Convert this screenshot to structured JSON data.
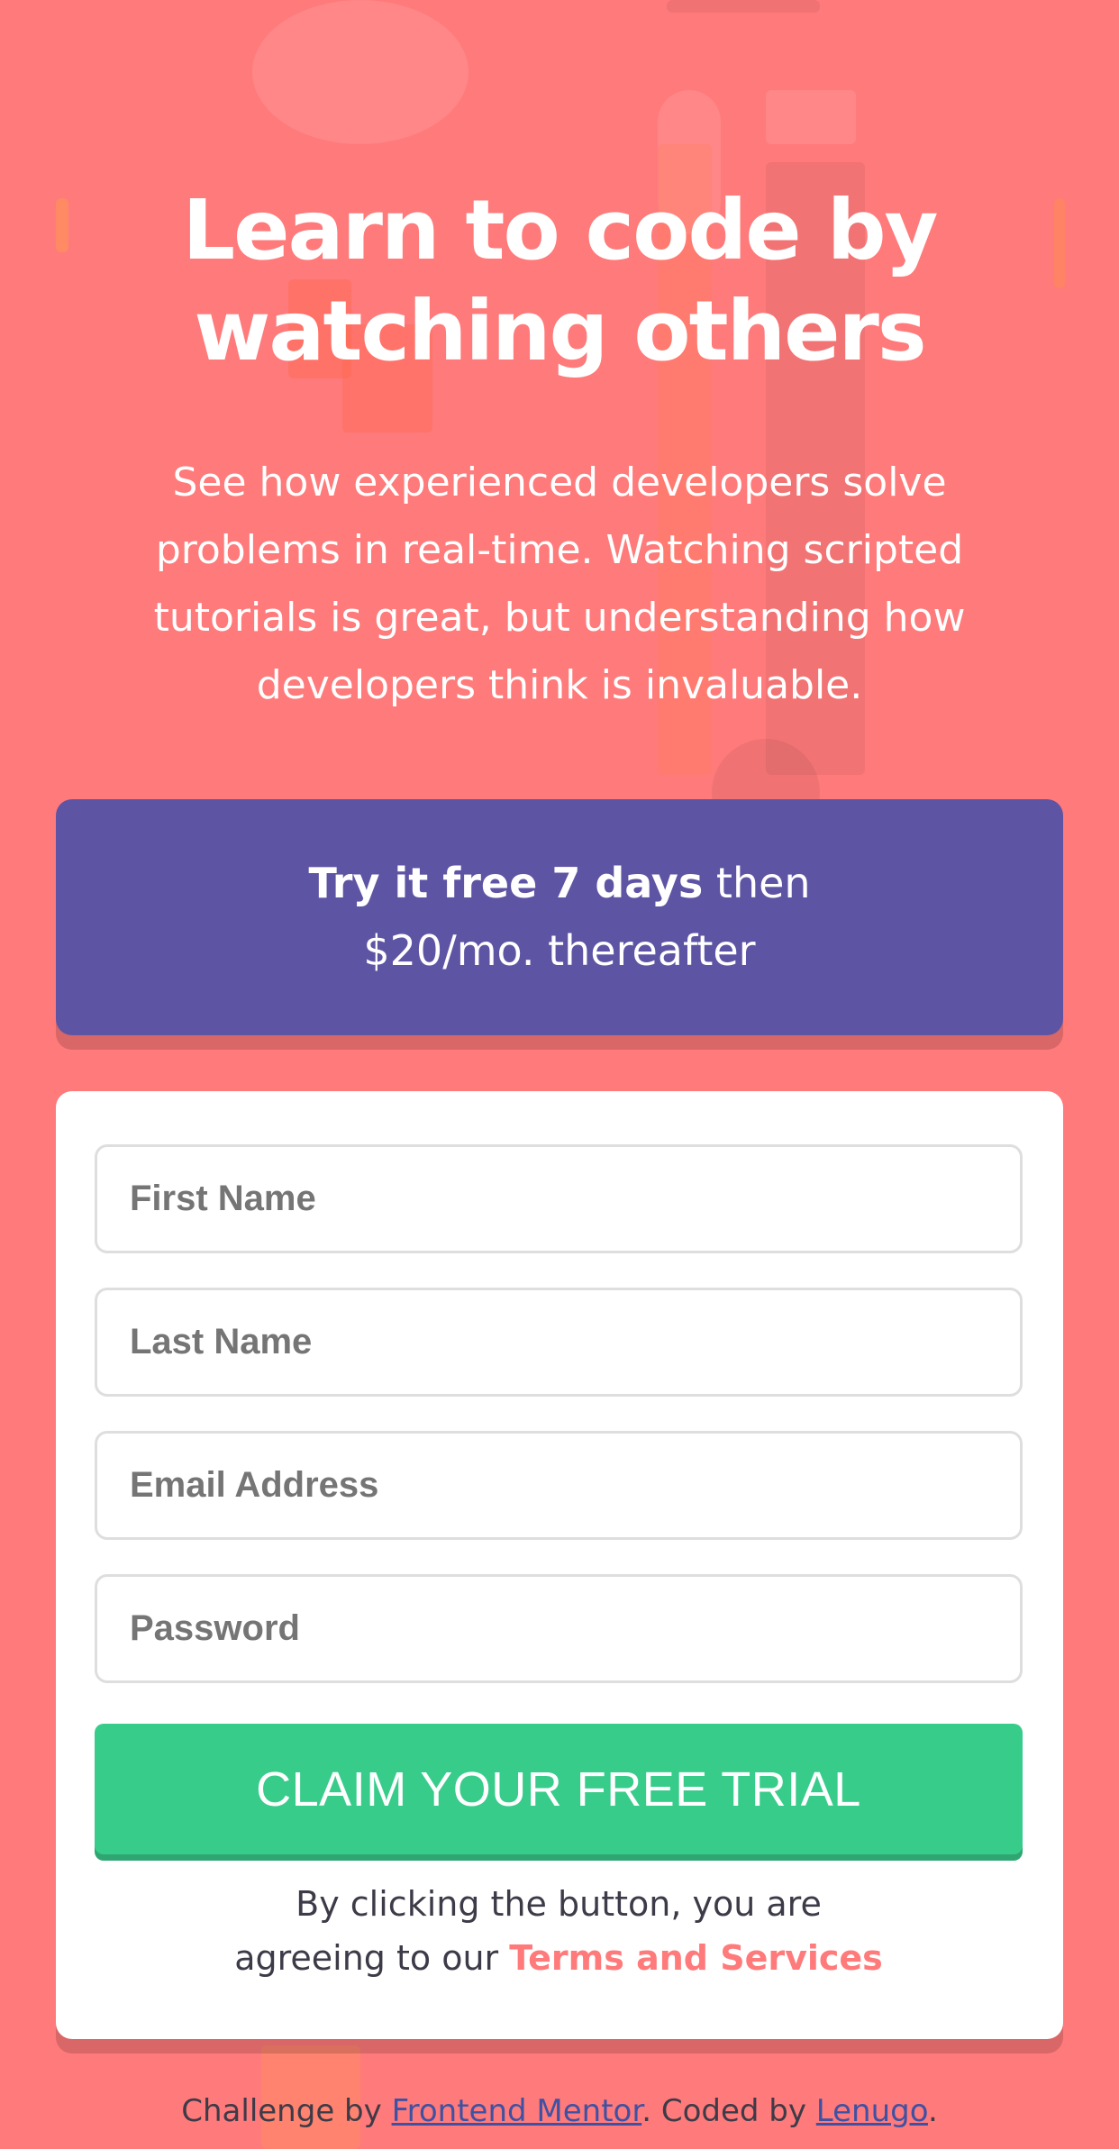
{
  "colors": {
    "background": "#ff7a7a",
    "promo_bg": "#5e54a4",
    "card_bg": "#ffffff",
    "button_bg": "#38cc8b",
    "terms_link": "#ff7a7a",
    "footer_link": "#3e52a3"
  },
  "hero": {
    "title_line1": "Learn to code by",
    "title_line2": "watching others",
    "description": "See how experienced developers solve problems in real-time. Watching scripted tutorials is great, but understanding how developers think is invaluable."
  },
  "promo": {
    "bold": "Try it free 7 days",
    "rest": " then $20/mo. thereafter"
  },
  "form": {
    "first_name_placeholder": "First Name",
    "last_name_placeholder": "Last Name",
    "email_placeholder": "Email Address",
    "password_placeholder": "Password",
    "submit_label": "CLAIM YOUR FREE TRIAL",
    "terms_prefix_line1": "By clicking the button, you are",
    "terms_prefix_line2": "agreeing to our ",
    "terms_link": "Terms and Services"
  },
  "footer": {
    "prefix": "Challenge by ",
    "link1": "Frontend Mentor",
    "middle": ". Coded by ",
    "link2": "Lenugo",
    "suffix": "."
  }
}
